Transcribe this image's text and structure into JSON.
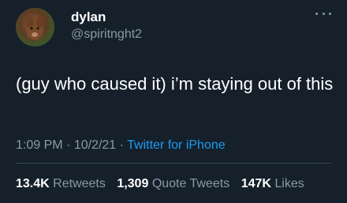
{
  "author": {
    "display_name": "dylan",
    "handle": "@spiritnght2",
    "avatar_icon": "profile-avatar"
  },
  "menu_icon": "more-horizontal-icon",
  "tweet": {
    "text": "(guy who caused it) i’m staying out of this",
    "time": "1:09 PM",
    "sep1": " · ",
    "date": "10/2/21",
    "sep2": " · ",
    "source": "Twitter for iPhone"
  },
  "stats": {
    "retweets": "13.4K",
    "retweets_label": "Retweets",
    "quote_tweets": "1,309",
    "quote_tweets_label": "Quote Tweets",
    "likes": "147K",
    "likes_label": "Likes"
  },
  "colors": {
    "background": "#15202b",
    "primary_text": "#ffffff",
    "secondary_text": "#8b98a5",
    "link": "#1d9bf0",
    "divider": "#38444d"
  }
}
